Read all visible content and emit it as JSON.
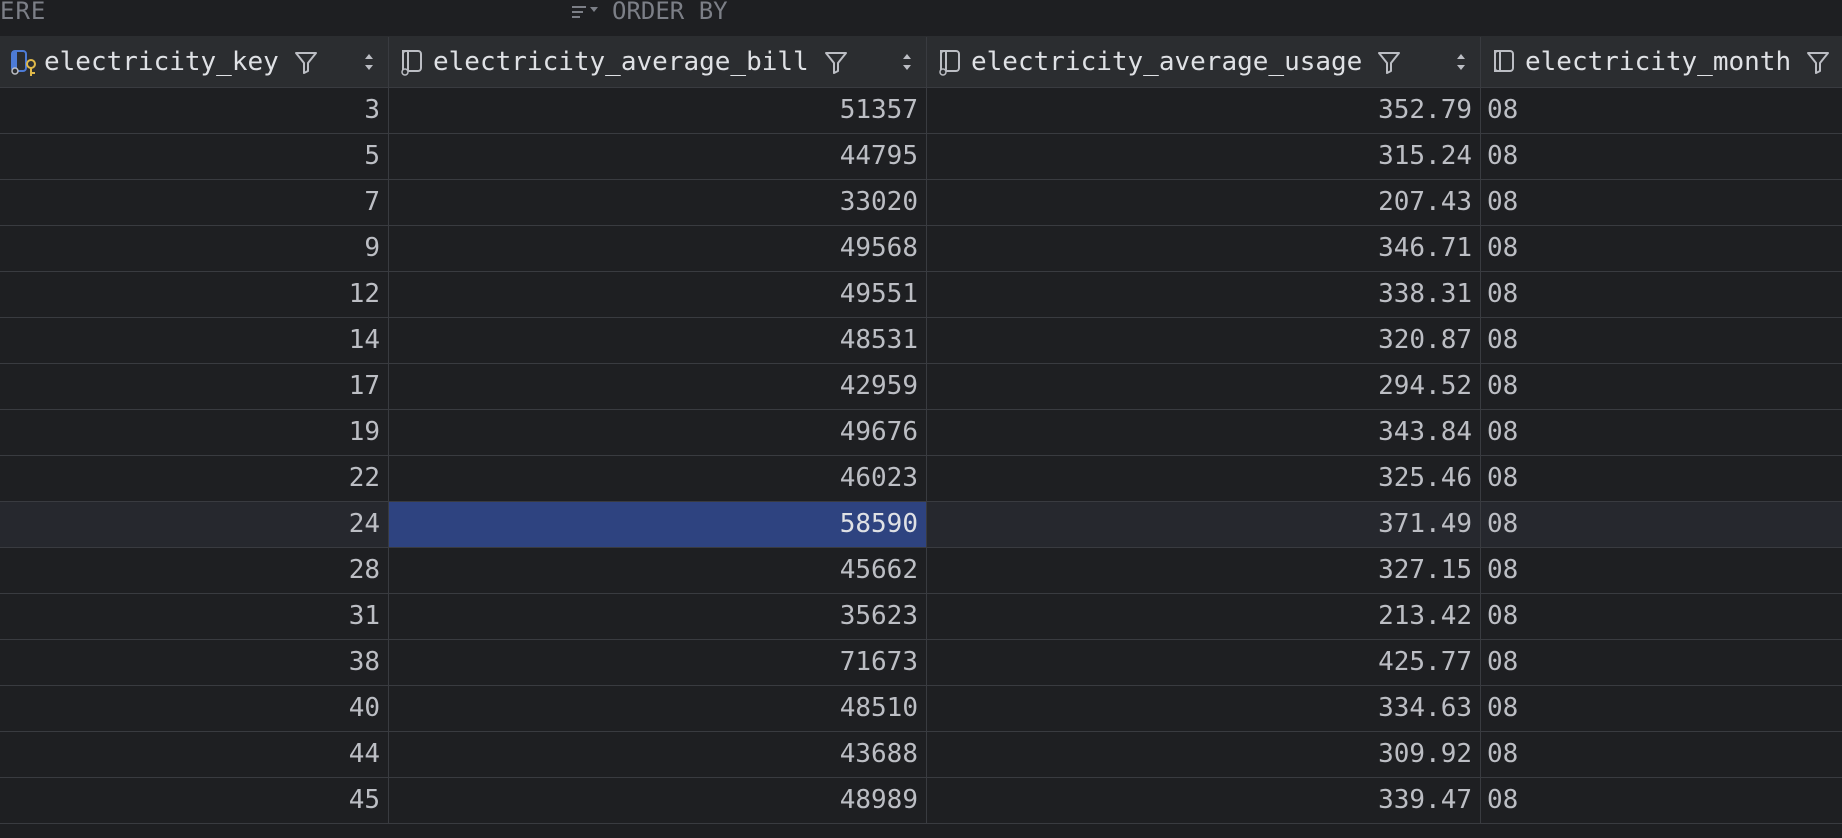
{
  "filter_bar": {
    "where_label": "ERE",
    "order_by_label": "ORDER BY"
  },
  "columns": [
    {
      "label": "electricity_key",
      "icon": "primary-key-column-icon"
    },
    {
      "label": "electricity_average_bill",
      "icon": "column-icon"
    },
    {
      "label": "electricity_average_usage",
      "icon": "column-icon"
    },
    {
      "label": "electricity_month",
      "icon": "column-icon"
    }
  ],
  "rows": [
    {
      "key": "3",
      "bill": "51357",
      "usage": "352.79",
      "month": "08"
    },
    {
      "key": "5",
      "bill": "44795",
      "usage": "315.24",
      "month": "08"
    },
    {
      "key": "7",
      "bill": "33020",
      "usage": "207.43",
      "month": "08"
    },
    {
      "key": "9",
      "bill": "49568",
      "usage": "346.71",
      "month": "08"
    },
    {
      "key": "12",
      "bill": "49551",
      "usage": "338.31",
      "month": "08"
    },
    {
      "key": "14",
      "bill": "48531",
      "usage": "320.87",
      "month": "08"
    },
    {
      "key": "17",
      "bill": "42959",
      "usage": "294.52",
      "month": "08"
    },
    {
      "key": "19",
      "bill": "49676",
      "usage": "343.84",
      "month": "08"
    },
    {
      "key": "22",
      "bill": "46023",
      "usage": "325.46",
      "month": "08"
    },
    {
      "key": "24",
      "bill": "58590",
      "usage": "371.49",
      "month": "08"
    },
    {
      "key": "28",
      "bill": "45662",
      "usage": "327.15",
      "month": "08"
    },
    {
      "key": "31",
      "bill": "35623",
      "usage": "213.42",
      "month": "08"
    },
    {
      "key": "38",
      "bill": "71673",
      "usage": "425.77",
      "month": "08"
    },
    {
      "key": "40",
      "bill": "48510",
      "usage": "334.63",
      "month": "08"
    },
    {
      "key": "44",
      "bill": "43688",
      "usage": "309.92",
      "month": "08"
    },
    {
      "key": "45",
      "bill": "48989",
      "usage": "339.47",
      "month": "08"
    }
  ],
  "selection": {
    "row": 9,
    "column": "electricity_average_bill"
  },
  "colors": {
    "background": "#1e1f22",
    "header": "#2b2d30",
    "grid": "#393b40",
    "selected_cell": "#2e4380",
    "key_icon": "#4d7bd6",
    "key_badge": "#e0b94a"
  }
}
